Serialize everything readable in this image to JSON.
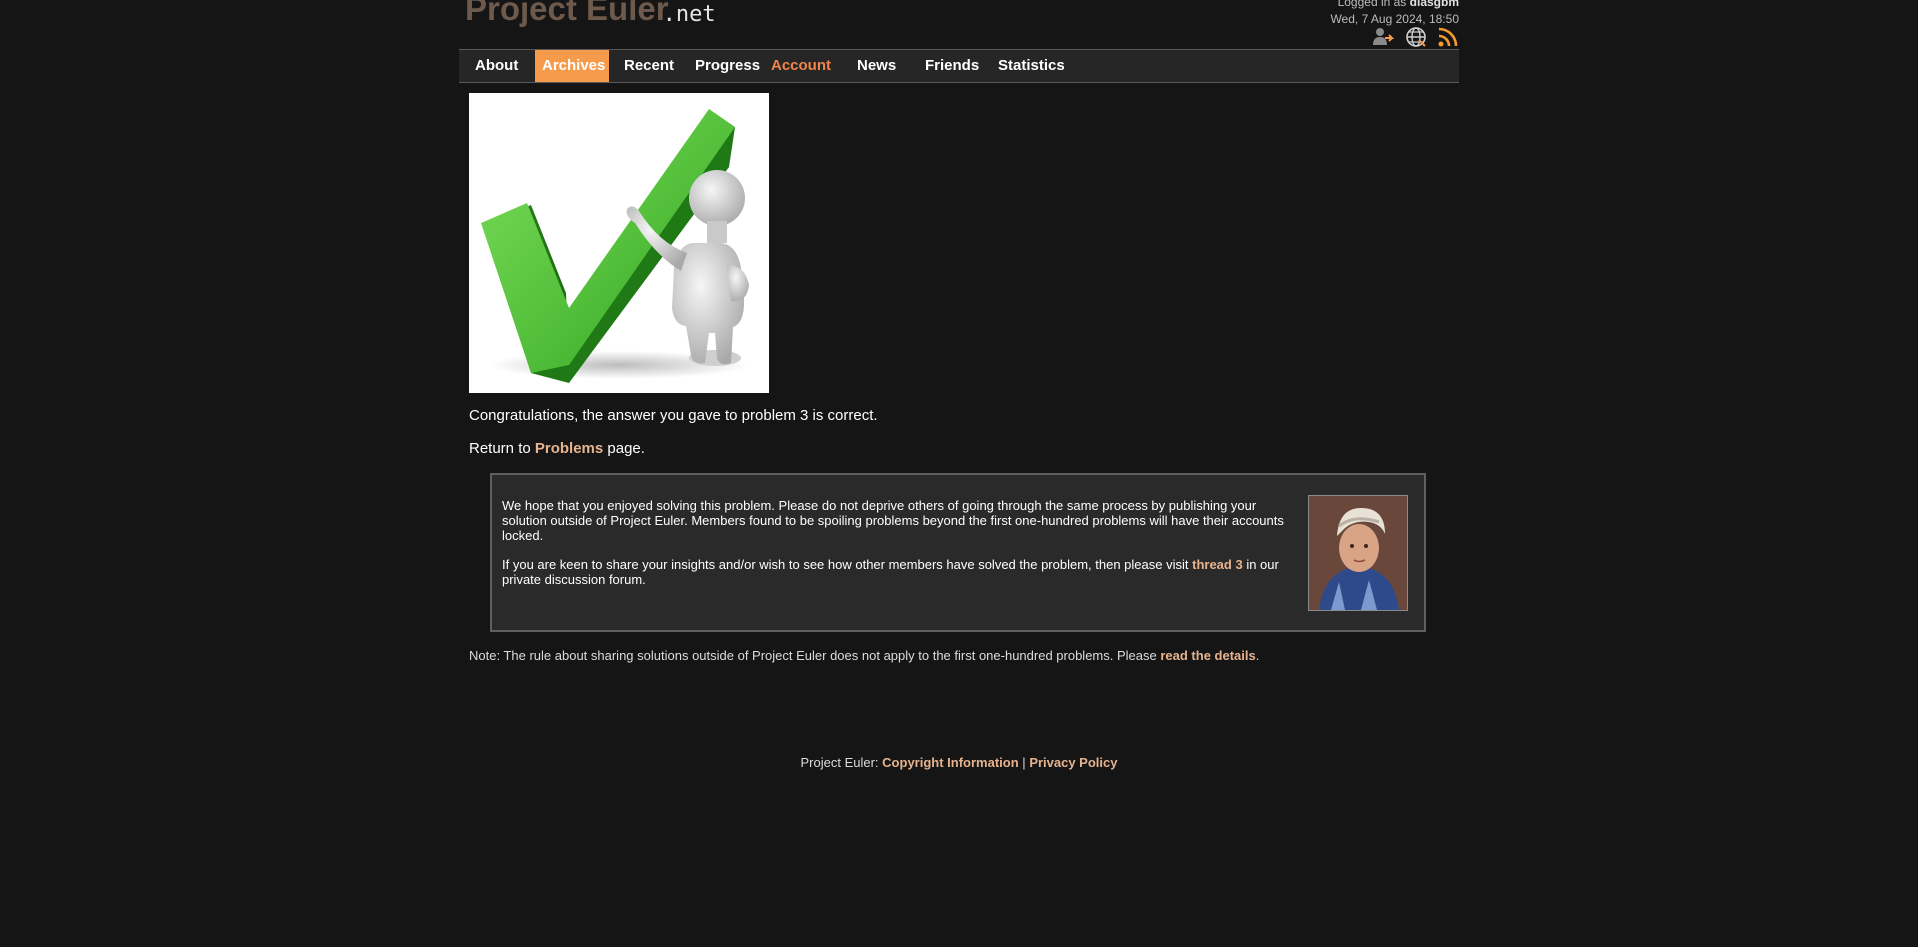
{
  "header": {
    "logo_main": "Project Euler",
    "logo_suffix": ".net",
    "logged_in_prefix": "Logged in as",
    "username": "diasgbm",
    "datetime": "Wed, 7 Aug 2024, 18:50",
    "icons": [
      "sign-out-icon",
      "globe-icon",
      "rss-icon"
    ]
  },
  "nav": {
    "items": [
      {
        "label": "About"
      },
      {
        "label": "Archives"
      },
      {
        "label": "Recent"
      },
      {
        "label": "Progress"
      },
      {
        "label": "Account"
      },
      {
        "label": "News"
      },
      {
        "label": "Friends"
      },
      {
        "label": "Statistics"
      }
    ],
    "active_color": "#f59b4b",
    "account_color": "#f0844a"
  },
  "main": {
    "congrats_text": "Congratulations, the answer you gave to problem 3 is correct.",
    "return_prefix": "Return to",
    "return_link": "Problems",
    "return_suffix": "page."
  },
  "infobox": {
    "para1": "We hope that you enjoyed solving this problem. Please do not deprive others of going through the same process by publishing your solution outside of Project Euler. Members found to be spoiling problems beyond the first one-hundred problems will have their accounts locked.",
    "para2_prefix": "If you are keen to share your insights and/or wish to see how other members have solved the problem, then please visit",
    "para2_link": "thread 3",
    "para2_suffix": "in our private discussion forum."
  },
  "note": {
    "prefix": "Note: The rule about sharing solutions outside of Project Euler does not apply to the first one-hundred problems. Please",
    "link": "read the details",
    "suffix": "."
  },
  "footer": {
    "prefix": "Project Euler:",
    "copyright": "Copyright Information",
    "separator": "|",
    "privacy": "Privacy Policy"
  },
  "colors": {
    "background": "#151515",
    "link": "#e6b38e",
    "logo": "#6e5a4c"
  }
}
